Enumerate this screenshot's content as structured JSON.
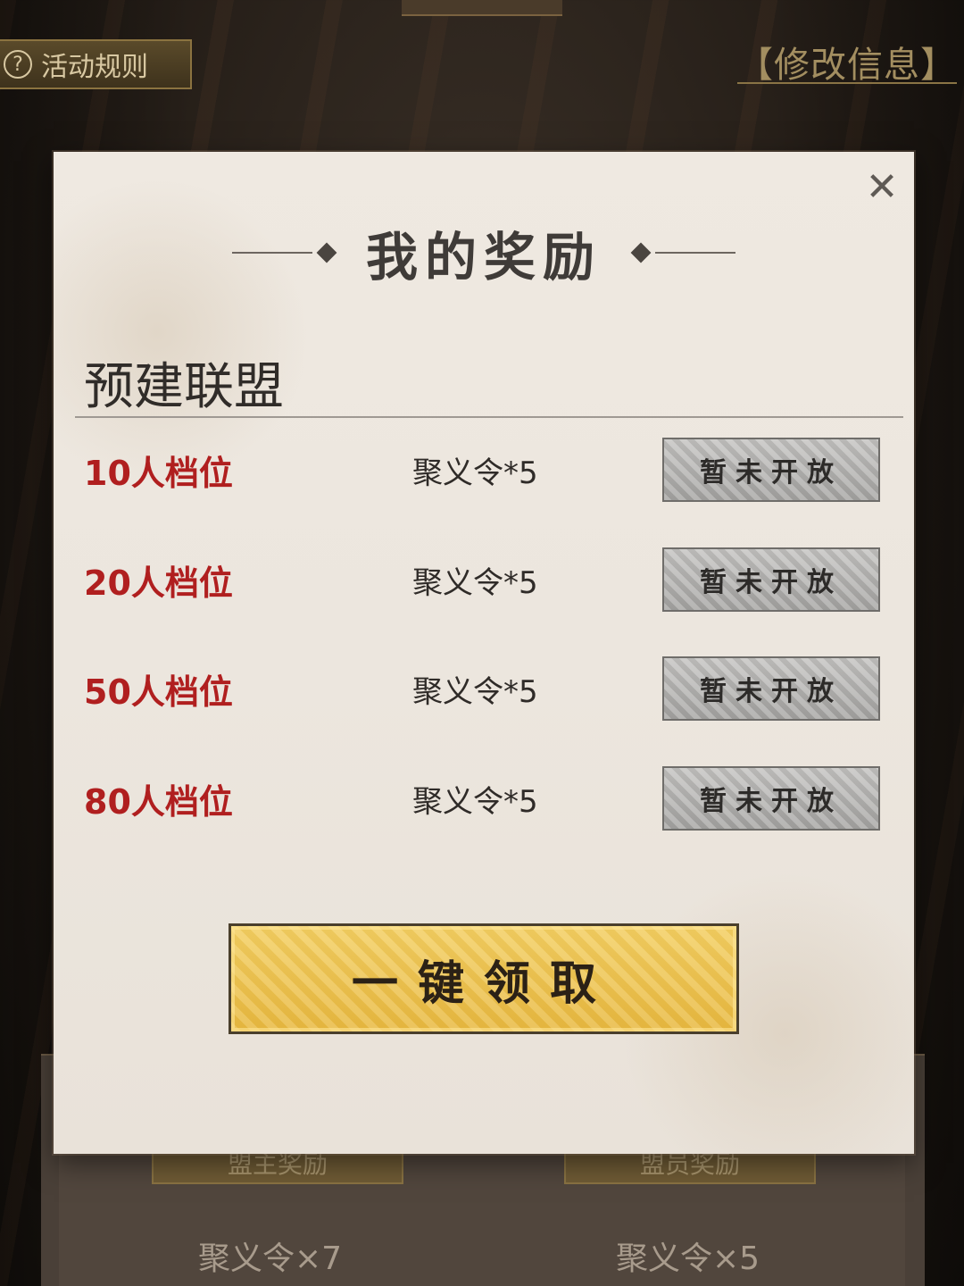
{
  "background": {
    "rules_label": "活动规则",
    "rules_icon": "?",
    "modify_info_link": "【修改信息】",
    "left_tag": "盟主奖励",
    "right_tag": "盟员奖励",
    "left_reward": "聚义令×7",
    "right_reward": "聚义令×5"
  },
  "modal": {
    "title": "我的奖励",
    "close_symbol": "✕",
    "section_title": "预建联盟",
    "tiers": [
      {
        "label": "10人档位",
        "reward": "聚义令*5",
        "button": "暂未开放"
      },
      {
        "label": "20人档位",
        "reward": "聚义令*5",
        "button": "暂未开放"
      },
      {
        "label": "50人档位",
        "reward": "聚义令*5",
        "button": "暂未开放"
      },
      {
        "label": "80人档位",
        "reward": "聚义令*5",
        "button": "暂未开放"
      }
    ],
    "claim_all_button": "一键领取"
  },
  "colors": {
    "tier_label": "#b01f1f",
    "claim_button": "#efc24f",
    "disabled_button": "#b5b4b2",
    "panel": "#ece6de"
  }
}
